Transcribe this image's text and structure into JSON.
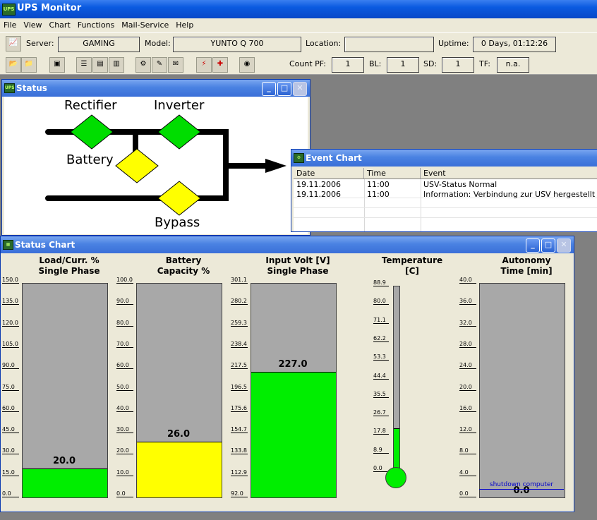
{
  "app": {
    "title": "UPS Monitor",
    "icon_text": "UPS"
  },
  "menu": [
    "File",
    "View",
    "Chart",
    "Functions",
    "Mail-Service",
    "Help"
  ],
  "info": {
    "server_label": "Server:",
    "server": "GAMING",
    "model_label": "Model:",
    "model": "YUNTO Q 700",
    "location_label": "Location:",
    "location": "",
    "uptime_label": "Uptime:",
    "uptime": "0 Days, 01:12:26"
  },
  "counts": {
    "pf_label": "Count PF:",
    "pf": "1",
    "bl_label": "BL:",
    "bl": "1",
    "sd_label": "SD:",
    "sd": "1",
    "tf_label": "TF:",
    "tf": "n.a."
  },
  "status_window": {
    "title": "Status",
    "rectifier": "Rectifier",
    "inverter": "Inverter",
    "battery": "Battery",
    "bypass": "Bypass",
    "colors": {
      "ok": "#00dd00",
      "warn": "#ffff00"
    }
  },
  "event_window": {
    "title": "Event Chart",
    "columns": [
      "Date",
      "Time",
      "Event"
    ],
    "rows": [
      [
        "19.11.2006",
        "11:00",
        "USV-Status Normal"
      ],
      [
        "19.11.2006",
        "11:00",
        "Information: Verbindung zur USV hergestellt"
      ]
    ]
  },
  "chart_window": {
    "title": "Status Chart",
    "gauges": [
      {
        "title1": "Load/Curr. %",
        "title2": "Single Phase",
        "ticks": [
          "150.0",
          "135.0",
          "120.0",
          "105.0",
          "90.0",
          "75.0",
          "60.0",
          "45.0",
          "30.0",
          "15.0",
          "0.0"
        ],
        "min": 0,
        "max": 150,
        "value": 20,
        "value_text": "20.0",
        "color": "#00ee00"
      },
      {
        "title1": "Battery",
        "title2": "Capacity %",
        "ticks": [
          "100.0",
          "90.0",
          "80.0",
          "70.0",
          "60.0",
          "50.0",
          "40.0",
          "30.0",
          "20.0",
          "10.0",
          "0.0"
        ],
        "min": 0,
        "max": 100,
        "value": 26,
        "value_text": "26.0",
        "color": "#ffff00"
      },
      {
        "title1": "Input Volt [V]",
        "title2": "Single Phase",
        "ticks": [
          "301.1",
          "280.2",
          "259.3",
          "238.4",
          "217.5",
          "196.5",
          "175.6",
          "154.7",
          "133.8",
          "112.9",
          "92.0"
        ],
        "min": 92.0,
        "max": 322.0,
        "value": 227.0,
        "value_text": "227.0",
        "color": "#00ee00"
      },
      {
        "title1": "Temperature",
        "title2": "[C]",
        "ticks": [
          "88.9",
          "80.0",
          "71.1",
          "62.2",
          "53.3",
          "44.4",
          "35.5",
          "26.7",
          "17.8",
          "8.9",
          "0.0"
        ],
        "min": 0,
        "max": 97.8,
        "value": 23,
        "value_text": "",
        "color": "#00ee00"
      },
      {
        "title1": "Autonomy",
        "title2": "Time [min]",
        "ticks": [
          "40.0",
          "36.0",
          "32.0",
          "28.0",
          "24.0",
          "20.0",
          "16.0",
          "12.0",
          "8.0",
          "4.0",
          "0.0"
        ],
        "min": 0,
        "max": 40,
        "value": 0,
        "value_text": "0.0",
        "color": "#00ee00",
        "marker_label": "shutdown computer",
        "marker_value": 1.5
      }
    ]
  }
}
